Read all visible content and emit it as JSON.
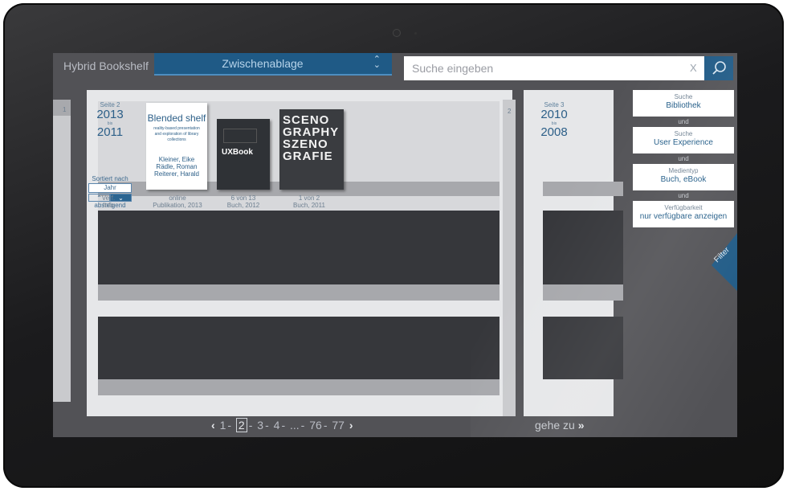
{
  "app": {
    "title": "Hybrid Bookshelf"
  },
  "collection": {
    "label": "Zwischenablage"
  },
  "search": {
    "placeholder": "Suche eingeben",
    "clear": "X"
  },
  "left_edge": {
    "page1": "1",
    "page2": "2"
  },
  "page_left": {
    "page": "Seite 2",
    "year_from": "2013",
    "bis": "bis",
    "year_to": "2011",
    "sort_label": "Sortiert nach",
    "sort_field": "Jahr",
    "sort_order": "absteigend",
    "info": "Verf.\nInfo"
  },
  "page_right": {
    "page": "Seite 3",
    "year_from": "2010",
    "bis": "bis",
    "year_to": "2008"
  },
  "books": [
    {
      "title": "Blended shelf",
      "subtitle": "reality-based presentation and exploration of library collections",
      "authors": "Kleiner, Eike Rädle, Roman Reiterer, Harald",
      "caption1": "online",
      "caption2": "Publikation, 2013"
    },
    {
      "title": "UXBook",
      "caption1": "6 von 13",
      "caption2": "Buch, 2012"
    },
    {
      "title": "SCENO GRAPHY SZENO GRAFIE",
      "caption1": "1 von 2",
      "caption2": "Buch, 2011"
    }
  ],
  "filters": [
    {
      "type": "Suche",
      "value": "Bibliothek"
    },
    {
      "type": "Suche",
      "value": "User Experience"
    },
    {
      "type": "Medientyp",
      "value": "Buch, eBook"
    },
    {
      "type": "Verfügbarkeit",
      "value": "nur verfügbare anzeigen"
    }
  ],
  "filter_connector": "und",
  "filter_tab": "Filter",
  "pagination": {
    "pages": [
      "1",
      "2",
      "3",
      "4",
      "...",
      "76",
      "77"
    ],
    "current": "2"
  },
  "goto": {
    "label": "gehe zu"
  },
  "colors": {
    "accent": "#1f5a86",
    "screen": "#525256",
    "shelf": "#e6e7e9"
  }
}
